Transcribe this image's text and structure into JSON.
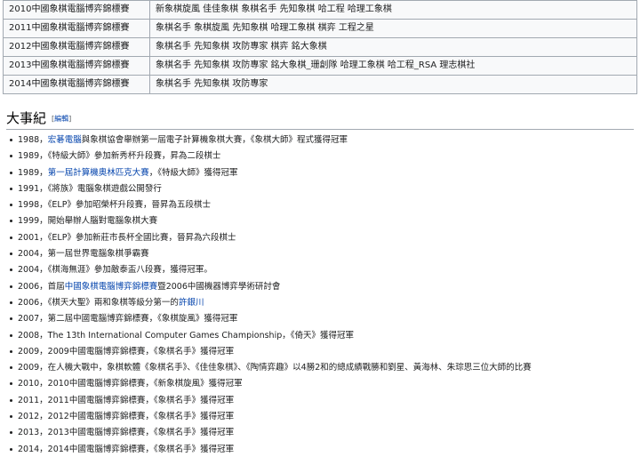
{
  "table": {
    "rows": [
      {
        "event": "2010中國象棋電腦博弈錦標賽",
        "winners": "新象棋旋風 佳佳象棋 象棋名手 先知象棋 哈工程 哈理工象棋"
      },
      {
        "event": "2011中國象棋電腦博弈錦標賽",
        "winners": "象棋名手 象棋旋風 先知象棋 哈理工象棋 棋弈 工程之星"
      },
      {
        "event": "2012中國象棋電腦博弈錦標賽",
        "winners": "象棋名手 先知象棋 攻防專家 棋弈 銘大象棋"
      },
      {
        "event": "2013中國象棋電腦博弈錦標賽",
        "winners": "象棋名手 先知象棋 攻防專家 銘大象棋_珊創隊 哈理工象棋 哈工程_RSA 理志棋社"
      },
      {
        "event": "2014中國象棋電腦博弈錦標賽",
        "winners": "象棋名手 先知象棋 攻防專家"
      }
    ]
  },
  "section": {
    "title": "大事紀",
    "edit_open": "[",
    "edit_label": "編輯",
    "edit_close": "]"
  },
  "timeline": {
    "i0": {
      "a": "1988，",
      "link": "宏碁電腦",
      "b": "與象棋協會舉辦第一屆電子計算機象棋大賽，《象棋大師》程式獲得冠軍"
    },
    "i1": {
      "a": "1989，《特級大師》參加新秀杯升段賽，昇為二段棋士"
    },
    "i2": {
      "a": "1989，",
      "link": "第一屆計算機奧林匹克大賽",
      "b": "，《特級大師》獲得冠軍"
    },
    "i3": {
      "a": "1991，《將族》電腦象棋遊戲公開發行"
    },
    "i4": {
      "a": "1998，《ELP》參加昭榮杯升段賽，晉昇為五段棋士"
    },
    "i5": {
      "a": "1999，開始舉辦人腦對電腦象棋大賽"
    },
    "i6": {
      "a": "2001，《ELP》參加新莊市長杯全國比賽，晉昇為六段棋士"
    },
    "i7": {
      "a": "2004，第一屆世界電腦象棋爭霸賽"
    },
    "i8": {
      "a": "2004，《棋海無涯》參加敵泰盃八段賽，獲得冠軍。"
    },
    "i9": {
      "a": "2006，首屆",
      "link": "中國象棋電腦博弈錦標賽",
      "b": "暨2006中國機器博弈學術研討會"
    },
    "i10": {
      "a": "2006，《棋天大聖》兩和象棋等級分第一的",
      "link": "許銀川",
      "b": ""
    },
    "i11": {
      "a": "2007，第二屆中國電腦博弈錦標賽，《象棋旋風》獲得冠軍"
    },
    "i12": {
      "a": "2008，The 13th International Computer Games Championship，《倚天》獲得冠軍"
    },
    "i13": {
      "a": "2009，2009中國電腦博弈錦標賽，《象棋名手》獲得冠軍"
    },
    "i14": {
      "a": "2009，在人機大戰中，象棋軟體《象棋名手》、《佳佳象棋》、《陶情弈趣》以4勝2和的總成績戰勝和劉星、黃海林、朱琮思三位大師的比賽"
    },
    "i15": {
      "a": "2010，2010中國電腦博弈錦標賽，《新象棋旋風》獲得冠軍"
    },
    "i16": {
      "a": "2011，2011中國電腦博弈錦標賽，《象棋名手》獲得冠軍"
    },
    "i17": {
      "a": "2012，2012中國電腦博弈錦標賽，《象棋名手》獲得冠軍"
    },
    "i18": {
      "a": "2013，2013中國電腦博弈錦標賽，《象棋名手》獲得冠軍"
    },
    "i19": {
      "a": "2014，2014中國電腦博弈錦標賽，《象棋名手》獲得冠軍"
    }
  },
  "colors": {
    "link": "#0645ad",
    "text": "#202122",
    "table_bg": "#f8f9fa",
    "border": "#a2a9b1"
  }
}
